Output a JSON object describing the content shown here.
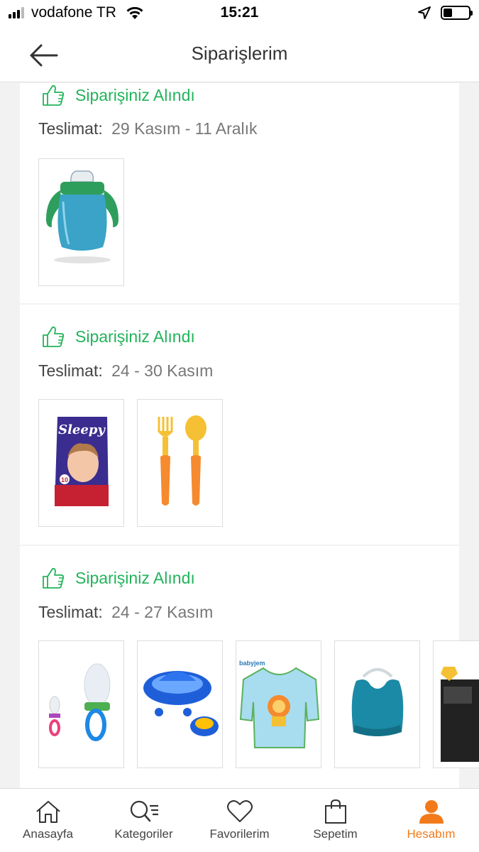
{
  "status_bar": {
    "carrier": "vodafone TR",
    "time": "15:21",
    "battery_level": 0.35
  },
  "nav": {
    "title": "Siparişlerim"
  },
  "orders": [
    {
      "status": "Siparişiniz Alındı",
      "delivery_label": "Teslimat:",
      "delivery_date": "29 Kasım - 11 Aralık",
      "products": [
        "sippy-cup"
      ]
    },
    {
      "status": "Siparişiniz Alındı",
      "delivery_label": "Teslimat:",
      "delivery_date": "24 - 30 Kasım",
      "products": [
        "diaper-pack",
        "baby-cutlery"
      ],
      "product_text": {
        "brand": "Sleepy",
        "count": "10"
      }
    },
    {
      "status": "Siparişiniz Alındı",
      "delivery_label": "Teslimat:",
      "delivery_date": "24 - 27 Kasım",
      "products": [
        "fruit-feeder",
        "gyro-bowl",
        "baby-bib-sleeved",
        "silicone-bib",
        "partial-product"
      ],
      "product_text": {
        "bib_brand": "babyjem"
      }
    }
  ],
  "tabs": [
    {
      "label": "Anasayfa",
      "icon": "home-icon"
    },
    {
      "label": "Kategoriler",
      "icon": "category-search-icon"
    },
    {
      "label": "Favorilerim",
      "icon": "heart-icon"
    },
    {
      "label": "Sepetim",
      "icon": "shopping-bag-icon"
    },
    {
      "label": "Hesabım",
      "icon": "user-icon",
      "active": true
    }
  ],
  "colors": {
    "status_green": "#22b35a",
    "active_tab": "#f27a1a"
  }
}
